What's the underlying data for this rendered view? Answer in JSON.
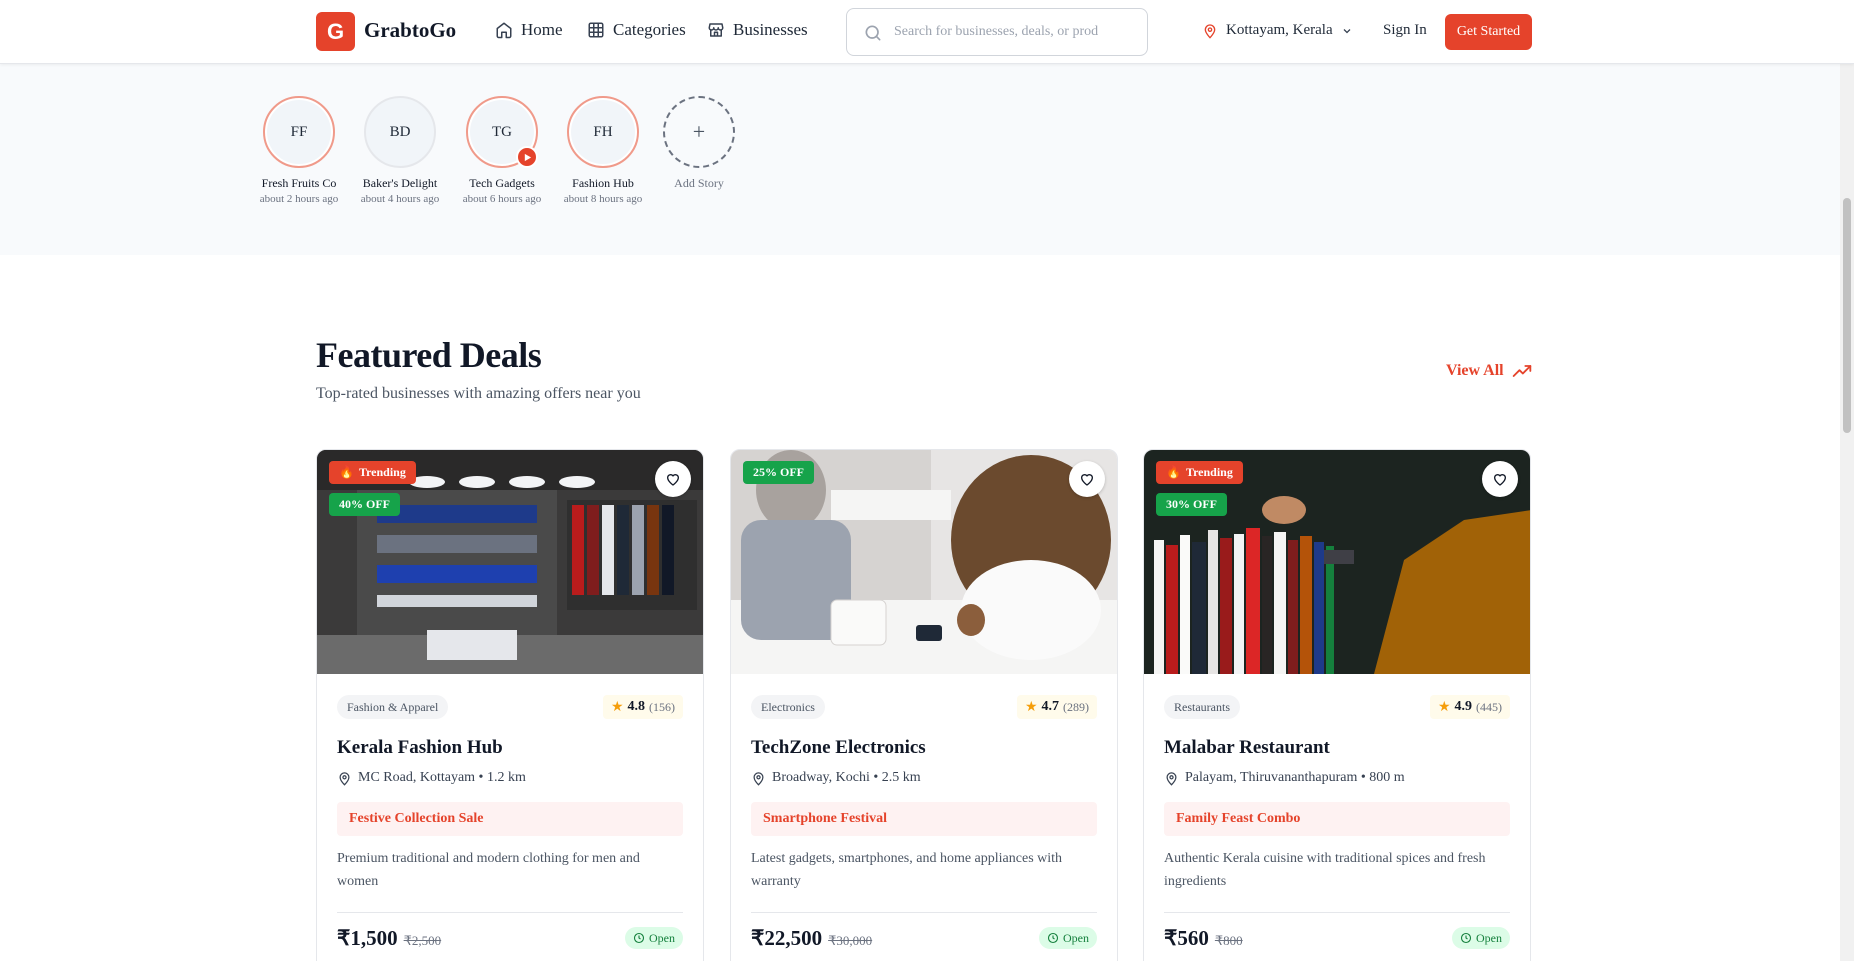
{
  "header": {
    "logo_letter": "G",
    "brand": "GrabtoGo",
    "nav": [
      {
        "label": "Home",
        "icon": "home-icon"
      },
      {
        "label": "Categories",
        "icon": "grid-icon"
      },
      {
        "label": "Businesses",
        "icon": "store-icon"
      }
    ],
    "search_placeholder": "Search for businesses, deals, or prod",
    "location": "Kottayam, Kerala",
    "sign_in": "Sign In",
    "get_started": "Get Started"
  },
  "stories": [
    {
      "initials": "FF",
      "name": "Fresh Fruits Co",
      "time": "about 2 hours ago",
      "state": "active"
    },
    {
      "initials": "BD",
      "name": "Baker's Delight",
      "time": "about 4 hours ago",
      "state": "seen"
    },
    {
      "initials": "TG",
      "name": "Tech Gadgets",
      "time": "about 6 hours ago",
      "state": "active"
    },
    {
      "initials": "FH",
      "name": "Fashion Hub",
      "time": "about 8 hours ago",
      "state": "active"
    },
    {
      "initials": "+",
      "name": "Add Story",
      "time": "",
      "state": "add"
    }
  ],
  "featured": {
    "title": "Featured Deals",
    "subtitle": "Top-rated businesses with amazing offers near you",
    "view_all": "View All"
  },
  "deals": [
    {
      "trending": "Trending",
      "discount": "40% OFF",
      "category": "Fashion & Apparel",
      "rating": "4.8",
      "reviews": "(156)",
      "name": "Kerala Fashion Hub",
      "address": "MC Road, Kottayam • 1.2 km",
      "offer": "Festive Collection Sale",
      "description": "Premium traditional and modern clothing for men and women",
      "price": "₹1,500",
      "old_price": "₹2,500",
      "status": "Open"
    },
    {
      "trending": "",
      "discount": "25% OFF",
      "category": "Electronics",
      "rating": "4.7",
      "reviews": "(289)",
      "name": "TechZone Electronics",
      "address": "Broadway, Kochi • 2.5 km",
      "offer": "Smartphone Festival",
      "description": "Latest gadgets, smartphones, and home appliances with warranty",
      "price": "₹22,500",
      "old_price": "₹30,000",
      "status": "Open"
    },
    {
      "trending": "Trending",
      "discount": "30% OFF",
      "category": "Restaurants",
      "rating": "4.9",
      "reviews": "(445)",
      "name": "Malabar Restaurant",
      "address": "Palayam, Thiruvananthapuram • 800 m",
      "offer": "Family Feast Combo",
      "description": "Authentic Kerala cuisine with traditional spices and fresh ingredients",
      "price": "₹560",
      "old_price": "₹800",
      "status": "Open"
    }
  ],
  "colors": {
    "brand": "#e5432b",
    "discount": "#16a34a",
    "open": "#15803d"
  }
}
